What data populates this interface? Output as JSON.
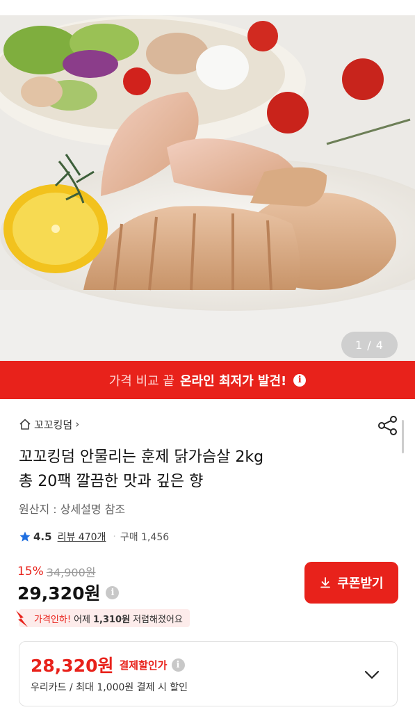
{
  "hero": {
    "page_indicator": "1 / 4"
  },
  "promo": {
    "lead": "가격 비교 끝",
    "highlight": "온라인 최저가 발견!",
    "info_icon": "info-icon"
  },
  "brand": {
    "name": "꼬꼬킹덤",
    "chevron": "›"
  },
  "product": {
    "title_line1": "꼬꼬킹덤 안물리는 훈제 닭가슴살 2kg",
    "title_line2": "총 20팩 깔끔한 맛과 깊은 향",
    "origin": "원산지 : 상세설명 참조",
    "rating": "4.5",
    "review_label": "리뷰 470개",
    "purchase_label": "구매 1,456"
  },
  "price": {
    "discount_pct": "15%",
    "original": "34,900원",
    "current": "29,320원",
    "coupon_button": "쿠폰받기",
    "drop_lead": "가격인하!",
    "drop_mid": "어제",
    "drop_amount": "1,310원",
    "drop_tail": "저렴해졌어요"
  },
  "payment": {
    "price": "28,320원",
    "label": "결제할인가",
    "sub": "우리카드 / 최대 1,000원 결제 시 할인"
  },
  "colors": {
    "accent": "#e8221b",
    "star": "#1f6fe0"
  }
}
